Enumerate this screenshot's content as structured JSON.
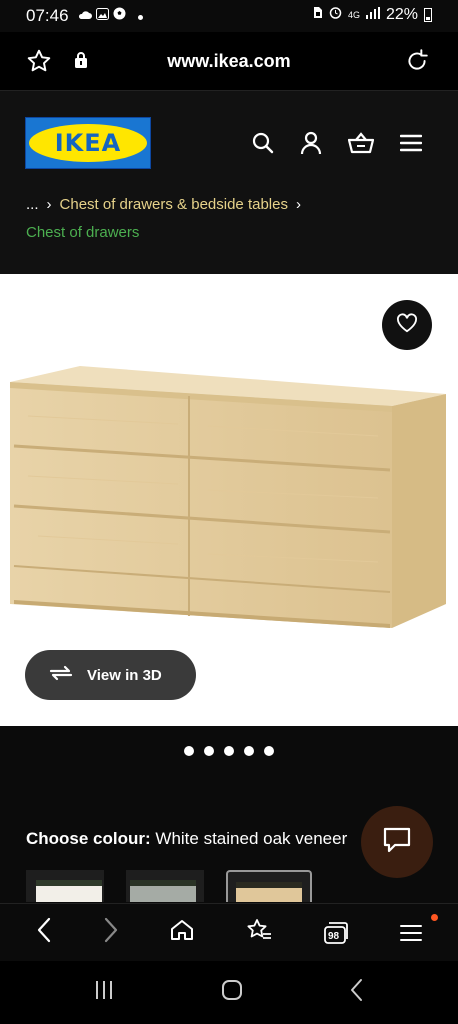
{
  "status": {
    "time": "07:46",
    "battery": "22%",
    "network": "4G"
  },
  "browser": {
    "url": "www.ikea.com",
    "tabs_count": "98"
  },
  "header": {
    "logo_text": "IKEA"
  },
  "breadcrumb": {
    "ellipsis": "...",
    "parent": "Chest of drawers & bedside tables",
    "current": "Chest of drawers"
  },
  "product": {
    "view3d_label": "View in 3D",
    "image_index": 1,
    "image_count": 5
  },
  "colour": {
    "label": "Choose colour:",
    "value": "White stained oak veneer"
  },
  "colors": {
    "accent_green": "#4caf50",
    "crumb_gold": "#e6d28a",
    "logo_blue": "#1976d2",
    "logo_yellow": "#ffe600",
    "chat_bg": "#3a1e10"
  }
}
